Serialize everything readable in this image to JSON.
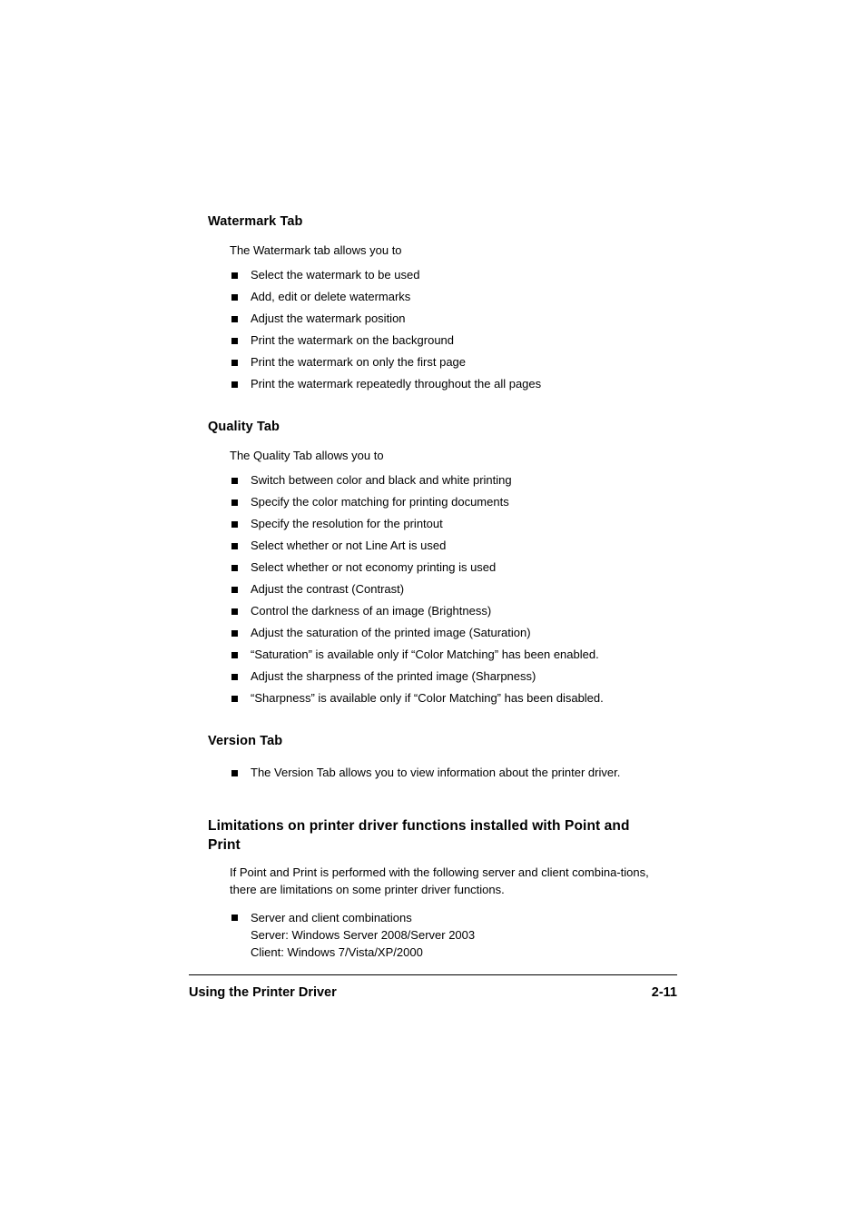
{
  "document": {
    "sections": [
      {
        "heading": "Watermark Tab",
        "intro": "The Watermark tab allows you to",
        "bullets": [
          "Select the watermark to be used",
          "Add, edit or delete watermarks",
          "Adjust the watermark position",
          "Print the watermark on the background",
          "Print the watermark on only the first page",
          "Print the watermark repeatedly throughout the all pages"
        ]
      },
      {
        "heading": "Quality Tab",
        "intro": "The Quality Tab allows you to",
        "bullets": [
          "Switch between color and black and white printing",
          "Specify the color matching for printing documents",
          "Specify the resolution for the printout",
          "Select whether or not Line Art is used",
          "Select whether or not economy printing is used",
          "Adjust the contrast (Contrast)",
          "Control the darkness of an image (Brightness)",
          "Adjust the saturation of the printed image (Saturation)",
          "“Saturation” is available only if “Color Matching” has been enabled.",
          "Adjust the sharpness of the printed image (Sharpness)",
          "“Sharpness” is available only if “Color Matching” has been disabled."
        ]
      },
      {
        "heading": "Version Tab",
        "bullets": [
          "The Version Tab allows you to view information about the printer driver."
        ]
      },
      {
        "heading": "Limitations on printer driver functions installed with Point and Print",
        "paragraph": "If Point and Print is performed with the following server and client combina-tions, there are limitations on some printer driver functions.",
        "bullet_multiline": {
          "line1": "Server and client combinations",
          "line2": "Server: Windows Server 2008/Server 2003",
          "line3": "Client: Windows 7/Vista/XP/2000"
        }
      }
    ]
  },
  "footer": {
    "label": "Using the Printer Driver",
    "page_number": "2-11"
  }
}
